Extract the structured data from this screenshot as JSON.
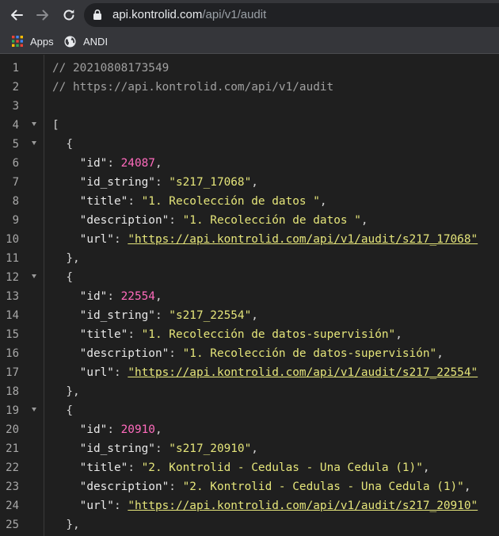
{
  "browser": {
    "url_host": "api.kontrolid.com",
    "url_path": "/api/v1/audit"
  },
  "bookmarks": [
    {
      "label": "Apps",
      "icon": "apps-grid-icon"
    },
    {
      "label": "ANDI",
      "icon": "globe-icon"
    }
  ],
  "code": {
    "line_numbers": [
      "1",
      "2",
      "3",
      "4",
      "5",
      "6",
      "7",
      "8",
      "9",
      "10",
      "11",
      "12",
      "13",
      "14",
      "15",
      "16",
      "17",
      "18",
      "19",
      "20",
      "21",
      "22",
      "23",
      "24",
      "25"
    ],
    "comment1": "// 20210808173549",
    "comment2": "// https://api.kontrolid.com/api/v1/audit",
    "open_bracket": "[",
    "open_brace": "{",
    "close_brace": "},",
    "records": [
      {
        "id": "24087",
        "id_string": "\"s217_17068\"",
        "title": "\"1. Recolección de datos \"",
        "description": "\"1. Recolección de datos \"",
        "url": "\"https://api.kontrolid.com/api/v1/audit/s217_17068\""
      },
      {
        "id": "22554",
        "id_string": "\"s217_22554\"",
        "title": "\"1. Recolección de datos-supervisión\"",
        "description": "\"1. Recolección de datos-supervisión\"",
        "url": "\"https://api.kontrolid.com/api/v1/audit/s217_22554\""
      },
      {
        "id": "20910",
        "id_string": "\"s217_20910\"",
        "title": "\"2. Kontrolid - Cedulas - Una Cedula (1)\"",
        "description": "\"2. Kontrolid - Cedulas - Una Cedula (1)\"",
        "url": "\"https://api.kontrolid.com/api/v1/audit/s217_20910\""
      }
    ],
    "keys": {
      "id": "\"id\"",
      "id_string": "\"id_string\"",
      "title": "\"title\"",
      "description": "\"description\"",
      "url": "\"url\""
    }
  }
}
